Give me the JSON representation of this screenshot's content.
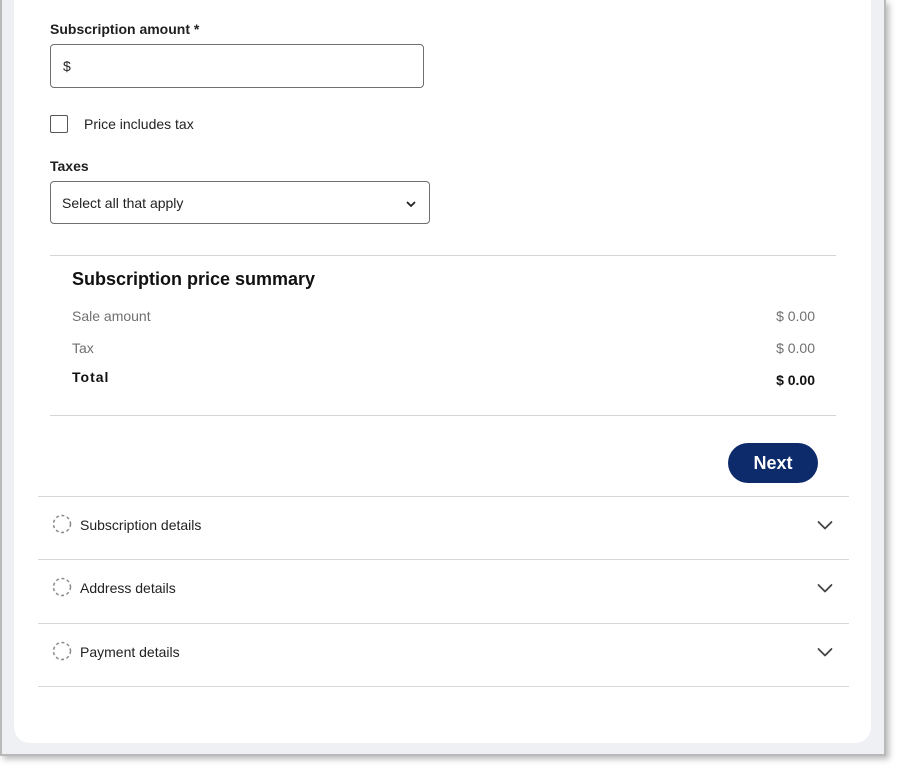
{
  "form": {
    "amount_label": "Subscription amount *",
    "amount_prefix": "$",
    "amount_value": "",
    "price_includes_tax_label": "Price includes tax",
    "price_includes_tax_checked": false,
    "taxes_label": "Taxes",
    "taxes_select_value": "Select all that apply"
  },
  "summary": {
    "title": "Subscription price summary",
    "rows": [
      {
        "label": "Sale amount",
        "value": "$ 0.00"
      },
      {
        "label": "Tax",
        "value": "$ 0.00"
      },
      {
        "label": "Total",
        "value": "$ 0.00"
      }
    ]
  },
  "actions": {
    "next_label": "Next"
  },
  "accordion": [
    {
      "label": "Subscription details",
      "icon": "dashed-circle-icon"
    },
    {
      "label": "Address details",
      "icon": "dashed-circle-icon"
    },
    {
      "label": "Payment details",
      "icon": "dashed-circle-icon"
    }
  ],
  "colors": {
    "primary_button": "#0d2a6b",
    "border": "#6f6f6f",
    "muted_text": "#707070"
  }
}
